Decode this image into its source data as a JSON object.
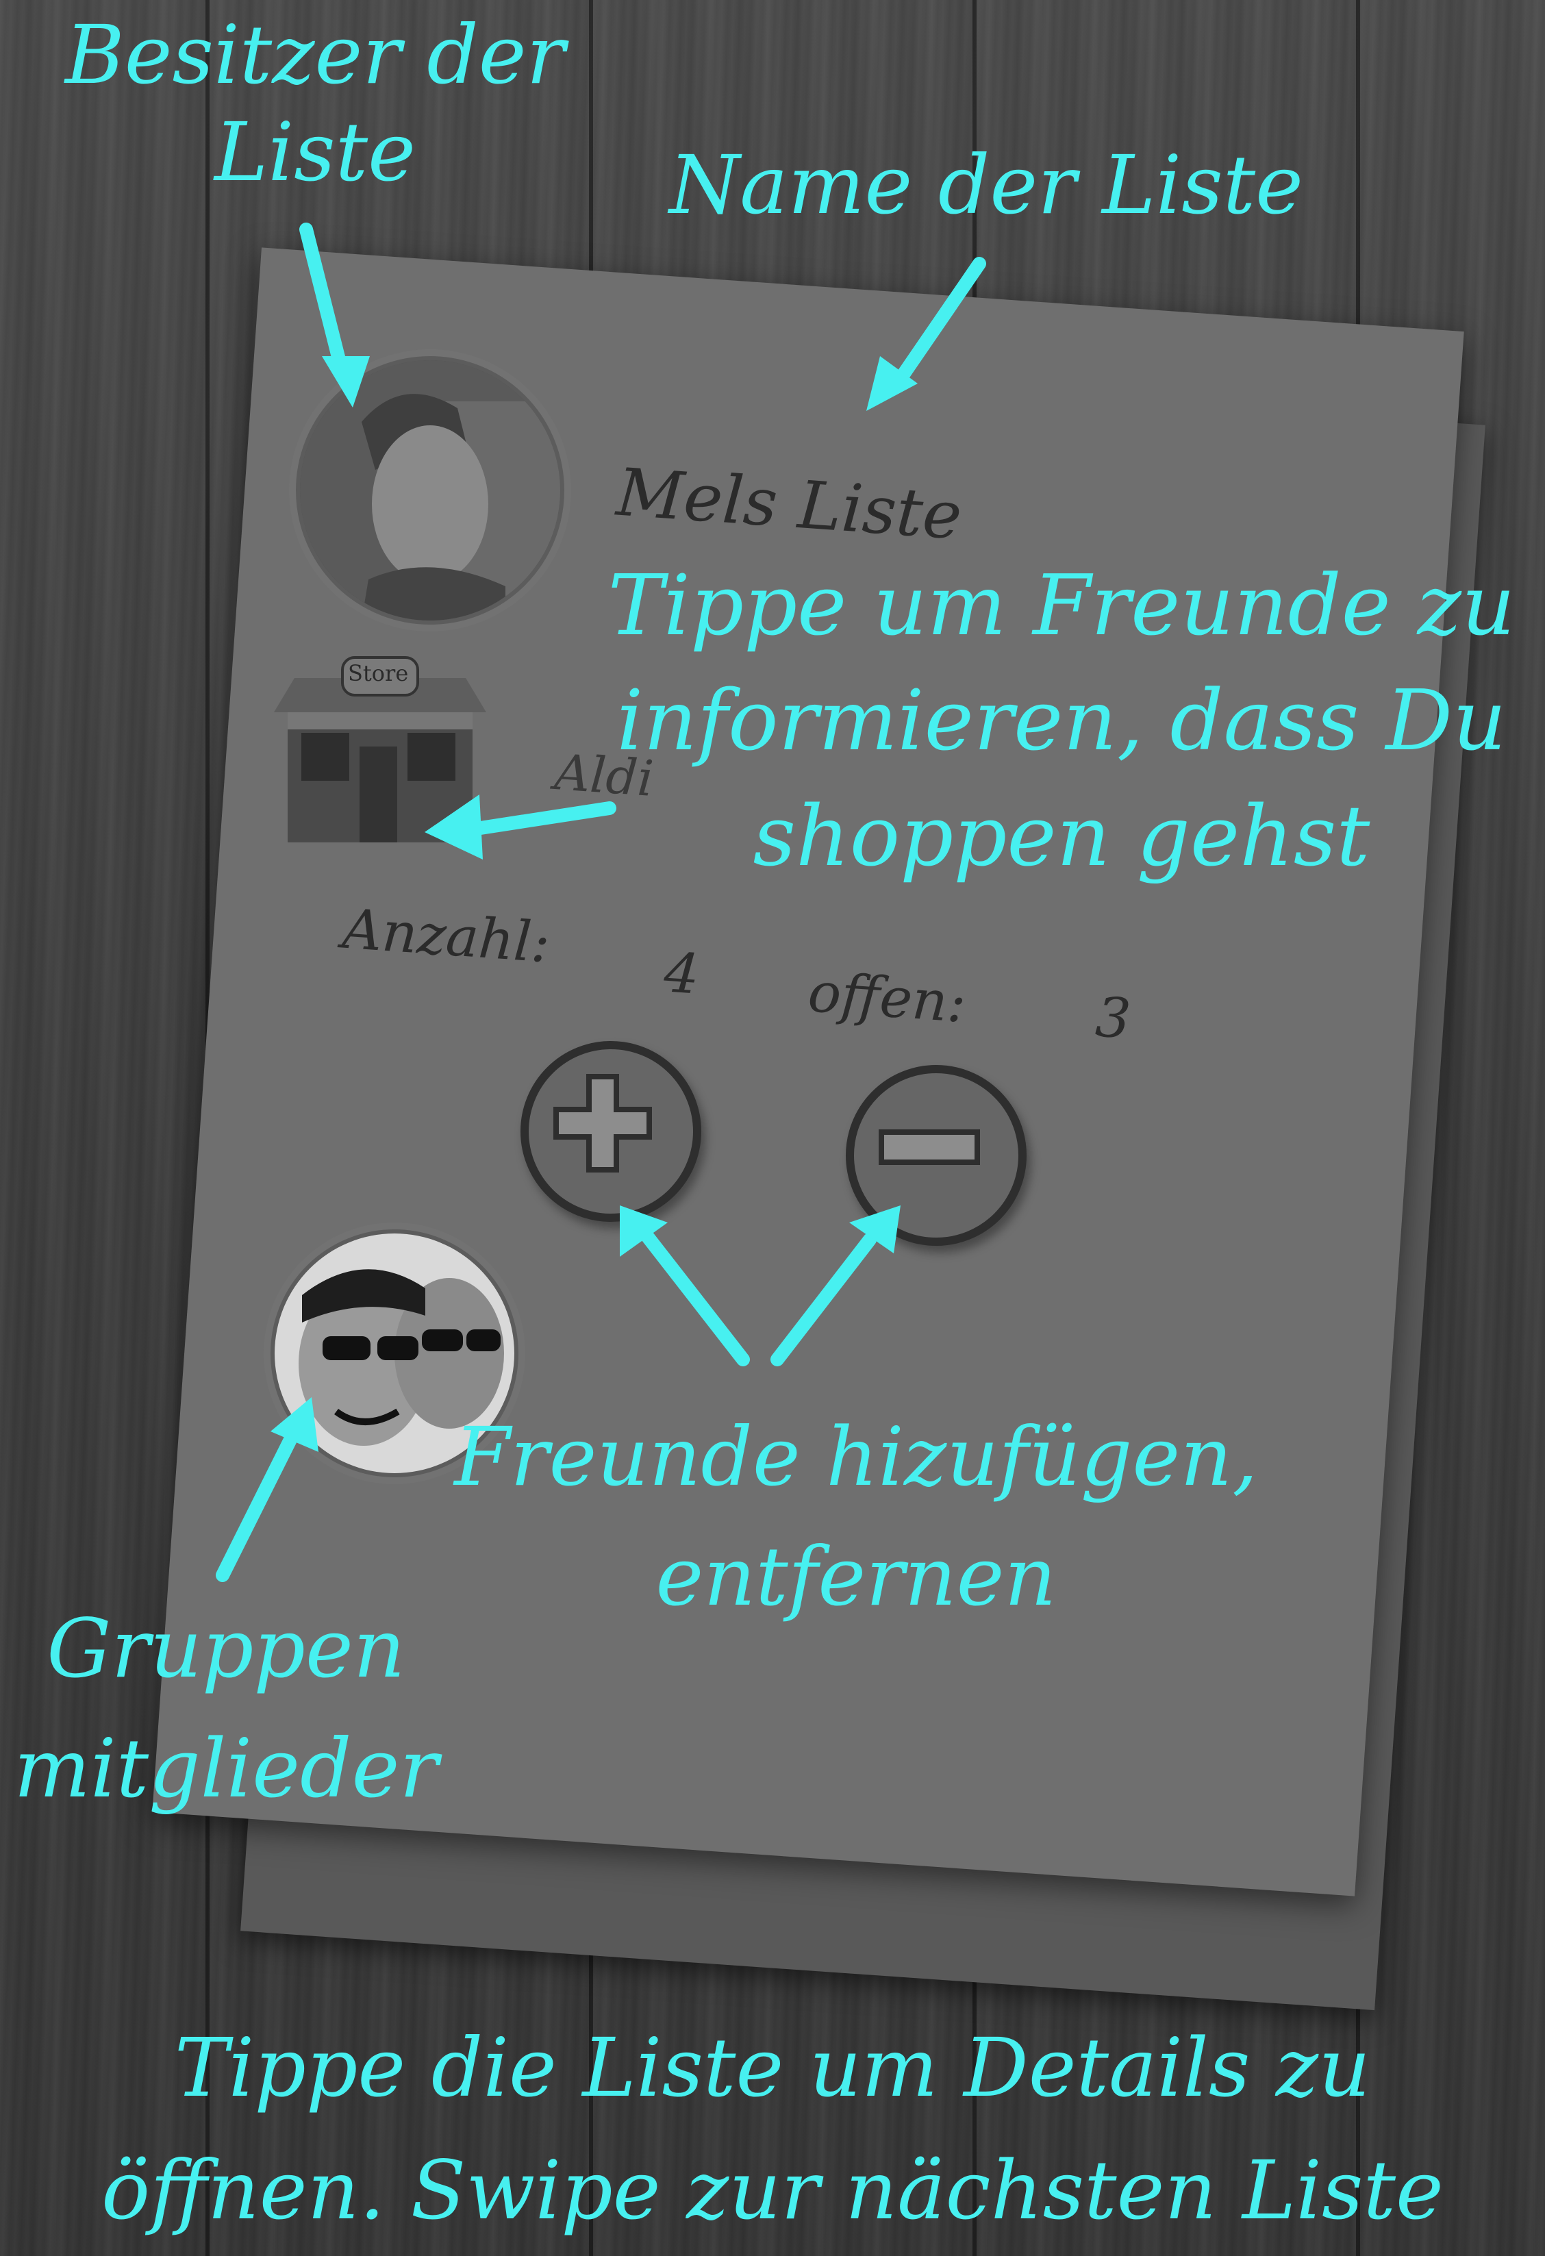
{
  "colors": {
    "annotation": "#47f0f0",
    "card": "#6f6f6f",
    "background": "#3d3d3d"
  },
  "card": {
    "list_name": "Mels Liste",
    "store_sign": "Store",
    "store_name": "Aldi",
    "count_label": "Anzahl:",
    "count_value": "4",
    "open_label": "offen:",
    "open_value": "3",
    "add_icon": "plus-icon",
    "remove_icon": "minus-icon"
  },
  "annotations": {
    "owner_line1": "Besitzer der",
    "owner_line2": "Liste",
    "list_name_label": "Name der Liste",
    "notify_line1": "Tippe um Freunde zu",
    "notify_line2": "informieren, dass Du",
    "notify_line3": "shoppen gehst",
    "friends_line1": "Freunde hizufügen,",
    "friends_line2": "entfernen",
    "group_line1": "Gruppen",
    "group_line2": "mitglieder",
    "footer_line1": "Tippe die Liste um Details zu",
    "footer_line2": "öffnen. Swipe zur nächsten Liste"
  }
}
